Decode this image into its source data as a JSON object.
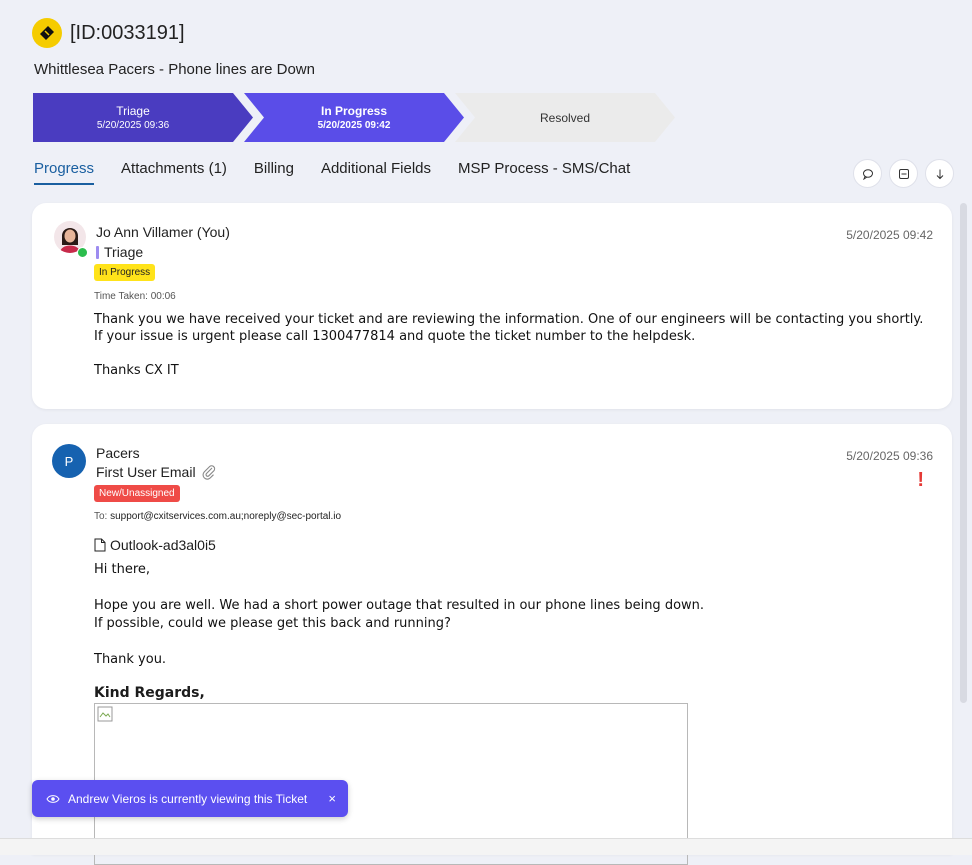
{
  "ticket": {
    "id": "[ID:0033191]",
    "subject": "Whittlesea Pacers - Phone lines are Down"
  },
  "stages": [
    {
      "name": "Triage",
      "date": "5/20/2025 09:36"
    },
    {
      "name": "In Progress",
      "date": "5/20/2025 09:42"
    },
    {
      "name": "Resolved",
      "date": ""
    }
  ],
  "tabs": [
    "Progress",
    "Attachments (1)",
    "Billing",
    "Additional Fields",
    "MSP Process - SMS/Chat"
  ],
  "entries": [
    {
      "author": "Jo Ann Villamer (You)",
      "stage": "Triage",
      "badge": "In Progress",
      "time_taken": "Time Taken: 00:06",
      "timestamp": "5/20/2025 09:42",
      "body": [
        "Thank you we have received your ticket and are reviewing the information. One of our engineers will be contacting you shortly.",
        "If your issue is urgent please call 1300477814 and quote the ticket number to the helpdesk.",
        "",
        "Thanks CX IT"
      ]
    },
    {
      "avatar_letter": "P",
      "author": "Pacers",
      "title": "First User Email",
      "badge": "New/Unassigned",
      "to_label": "To:",
      "to": "support@cxitservices.com.au;noreply@sec-portal.io",
      "timestamp": "5/20/2025 09:36",
      "priority": "!",
      "attachment": "Outlook-ad3al0i5",
      "body": [
        "Hi there,",
        "",
        "Hope you are well. We had a short power outage that resulted in our phone lines being down.",
        "If possible, could we please get this back and running?",
        "",
        "Thank you."
      ],
      "regards": "Kind Regards,"
    }
  ],
  "toast": {
    "message": "Andrew Vieros is currently viewing this Ticket",
    "close": "×"
  },
  "colors": {
    "stage_done": "#4a3cc0",
    "stage_active": "#5a4de8",
    "stage_pending": "#ebebeb",
    "badge_in_progress": "#ffe31a",
    "badge_new": "#ef4b47",
    "accent": "#1a5fa0"
  }
}
